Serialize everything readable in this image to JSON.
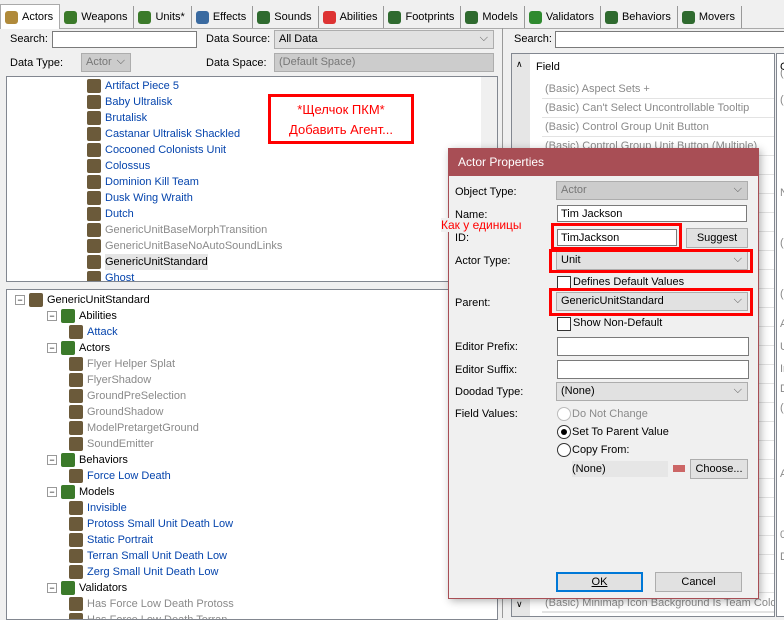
{
  "tabs": [
    {
      "label": "Actors",
      "color": "#b08a3a"
    },
    {
      "label": "Weapons",
      "color": "#3b7a2a"
    },
    {
      "label": "Units*",
      "color": "#3b7a2a"
    },
    {
      "label": "Effects",
      "color": "#3a6aa0"
    },
    {
      "label": "Sounds",
      "color": "#2f6a2f"
    },
    {
      "label": "Abilities",
      "color": "#d33"
    },
    {
      "label": "Footprints",
      "color": "#2f6a2f"
    },
    {
      "label": "Models",
      "color": "#2f6a2f"
    },
    {
      "label": "Validators",
      "color": "#2f8a2f"
    },
    {
      "label": "Behaviors",
      "color": "#2f6a2f"
    },
    {
      "label": "Movers",
      "color": "#2f6a2f"
    }
  ],
  "left": {
    "search_label": "Search:",
    "search_value": "",
    "data_source_label": "Data Source:",
    "data_source": "All Data",
    "data_type_label": "Data Type:",
    "data_type": "Actor",
    "data_space_label": "Data Space:",
    "data_space": "(Default Space)",
    "list": [
      {
        "t": "Artifact Piece 5",
        "c": "blue"
      },
      {
        "t": "Baby Ultralisk",
        "c": "blue"
      },
      {
        "t": "Brutalisk",
        "c": "blue"
      },
      {
        "t": "Castanar Ultralisk Shackled",
        "c": "blue"
      },
      {
        "t": "Cocooned Colonists Unit",
        "c": "blue"
      },
      {
        "t": "Colossus",
        "c": "blue"
      },
      {
        "t": "Dominion Kill Team",
        "c": "blue"
      },
      {
        "t": "Dusk Wing Wraith",
        "c": "blue"
      },
      {
        "t": "Dutch",
        "c": "blue"
      },
      {
        "t": "GenericUnitBaseMorphTransition",
        "c": "gray"
      },
      {
        "t": "GenericUnitBaseNoAutoSoundLinks",
        "c": "gray"
      },
      {
        "t": "GenericUnitStandard",
        "c": "sel"
      },
      {
        "t": "Ghost",
        "c": "blue"
      }
    ],
    "tree": [
      {
        "t": "GenericUnitStandard",
        "lvl": 0,
        "c": ""
      },
      {
        "t": "Abilities",
        "lvl": 1,
        "c": ""
      },
      {
        "t": "Attack",
        "lvl": 2,
        "c": "blue"
      },
      {
        "t": "Actors",
        "lvl": 1,
        "c": ""
      },
      {
        "t": "Flyer Helper Splat",
        "lvl": 2,
        "c": "gray"
      },
      {
        "t": "FlyerShadow",
        "lvl": 2,
        "c": "gray"
      },
      {
        "t": "GroundPreSelection",
        "lvl": 2,
        "c": "gray"
      },
      {
        "t": "GroundShadow",
        "lvl": 2,
        "c": "gray"
      },
      {
        "t": "ModelPretargetGround",
        "lvl": 2,
        "c": "gray"
      },
      {
        "t": "SoundEmitter",
        "lvl": 2,
        "c": "gray"
      },
      {
        "t": "Behaviors",
        "lvl": 1,
        "c": ""
      },
      {
        "t": "Force Low Death",
        "lvl": 2,
        "c": "blue"
      },
      {
        "t": "Models",
        "lvl": 1,
        "c": ""
      },
      {
        "t": "Invisible",
        "lvl": 2,
        "c": "blue"
      },
      {
        "t": "Protoss Small Unit Death Low",
        "lvl": 2,
        "c": "blue"
      },
      {
        "t": "Static Portrait",
        "lvl": 2,
        "c": "blue"
      },
      {
        "t": "Terran Small Unit Death Low",
        "lvl": 2,
        "c": "blue"
      },
      {
        "t": "Zerg Small Unit Death Low",
        "lvl": 2,
        "c": "blue"
      },
      {
        "t": "Validators",
        "lvl": 1,
        "c": ""
      },
      {
        "t": "Has Force Low Death Protoss",
        "lvl": 2,
        "c": "gray"
      },
      {
        "t": "Has Force Low Death Terran",
        "lvl": 2,
        "c": "gray"
      }
    ]
  },
  "annotation": {
    "line1": "*Щелчок ПКМ*",
    "line2": "Добавить Агент...",
    "note": "Как у единицы"
  },
  "right": {
    "search_label": "Search:",
    "field_header": "Field",
    "col2_header": "G",
    "fields": [
      "(Basic) Aspect Sets +",
      "(Basic) Can't Select Uncontrollable Tooltip",
      "(Basic) Control Group Unit Button",
      "(Basic) Control Group Unit Button (Multiple)"
    ],
    "last_field": "(Basic) Minimap Icon Background Is Team Colored",
    "col2": [
      "(N",
      "(N",
      "N",
      "(0",
      "(U",
      "A",
      "U",
      "In",
      "D",
      "(N",
      "A",
      "0",
      "D"
    ]
  },
  "dialog": {
    "title": "Actor Properties",
    "object_type_label": "Object Type:",
    "object_type": "Actor",
    "name_label": "Name:",
    "name": "Tim Jackson",
    "id_label": "ID:",
    "id": "TimJackson",
    "suggest": "Suggest",
    "actor_type_label": "Actor Type:",
    "actor_type": "Unit",
    "defines_default": "Defines Default Values",
    "parent_label": "Parent:",
    "parent": "GenericUnitStandard",
    "show_non_default": "Show Non-Default",
    "prefix_label": "Editor Prefix:",
    "suffix_label": "Editor Suffix:",
    "doodad_label": "Doodad Type:",
    "doodad": "(None)",
    "field_values_label": "Field Values:",
    "opt1": "Do Not Change",
    "opt2": "Set To Parent Value",
    "opt3": "Copy From:",
    "copy_from": "(None)",
    "choose": "Choose...",
    "ok": "OK",
    "cancel": "Cancel"
  }
}
